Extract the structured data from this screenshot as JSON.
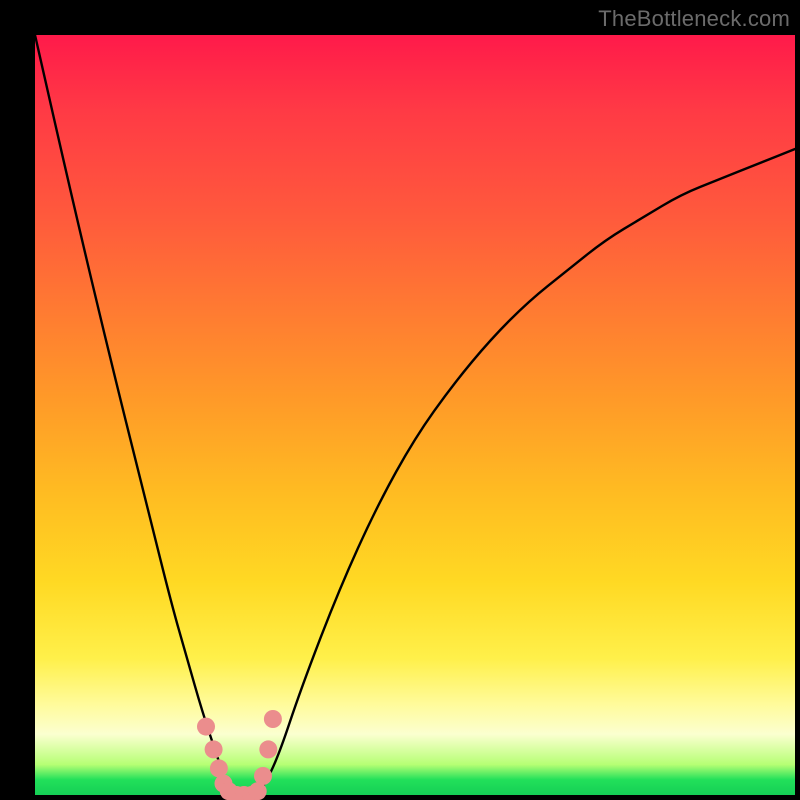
{
  "watermark": "TheBottleneck.com",
  "colors": {
    "frame": "#000000",
    "grad_top": "#ff1a4a",
    "grad_bottom": "#15cf55",
    "curve": "#000000",
    "marker": "#eb8d8d"
  },
  "chart_data": {
    "type": "line",
    "title": "",
    "xlabel": "",
    "ylabel": "",
    "xlim": [
      0,
      100
    ],
    "ylim": [
      0,
      100
    ],
    "x": [
      0,
      5,
      10,
      15,
      18,
      20,
      22,
      24,
      25,
      26,
      27,
      28,
      29,
      30,
      32,
      35,
      40,
      45,
      50,
      55,
      60,
      65,
      70,
      75,
      80,
      85,
      90,
      95,
      100
    ],
    "values": [
      100,
      78,
      57,
      37,
      25,
      18,
      11,
      5,
      2,
      0,
      0,
      0,
      0,
      1,
      5,
      14,
      27,
      38,
      47,
      54,
      60,
      65,
      69,
      73,
      76,
      79,
      81,
      83,
      85
    ],
    "annotations": "V-shaped curve touching zero near x≈26–29; pink markers cluster at the trough.",
    "markers": {
      "x": [
        22.5,
        23.5,
        24.2,
        24.8,
        25.5,
        26.5,
        27.5,
        28.5,
        29.3,
        30.0,
        30.7,
        31.3
      ],
      "y": [
        9,
        6,
        3.5,
        1.5,
        0.5,
        0,
        0,
        0,
        0.5,
        2.5,
        6,
        10
      ]
    }
  }
}
